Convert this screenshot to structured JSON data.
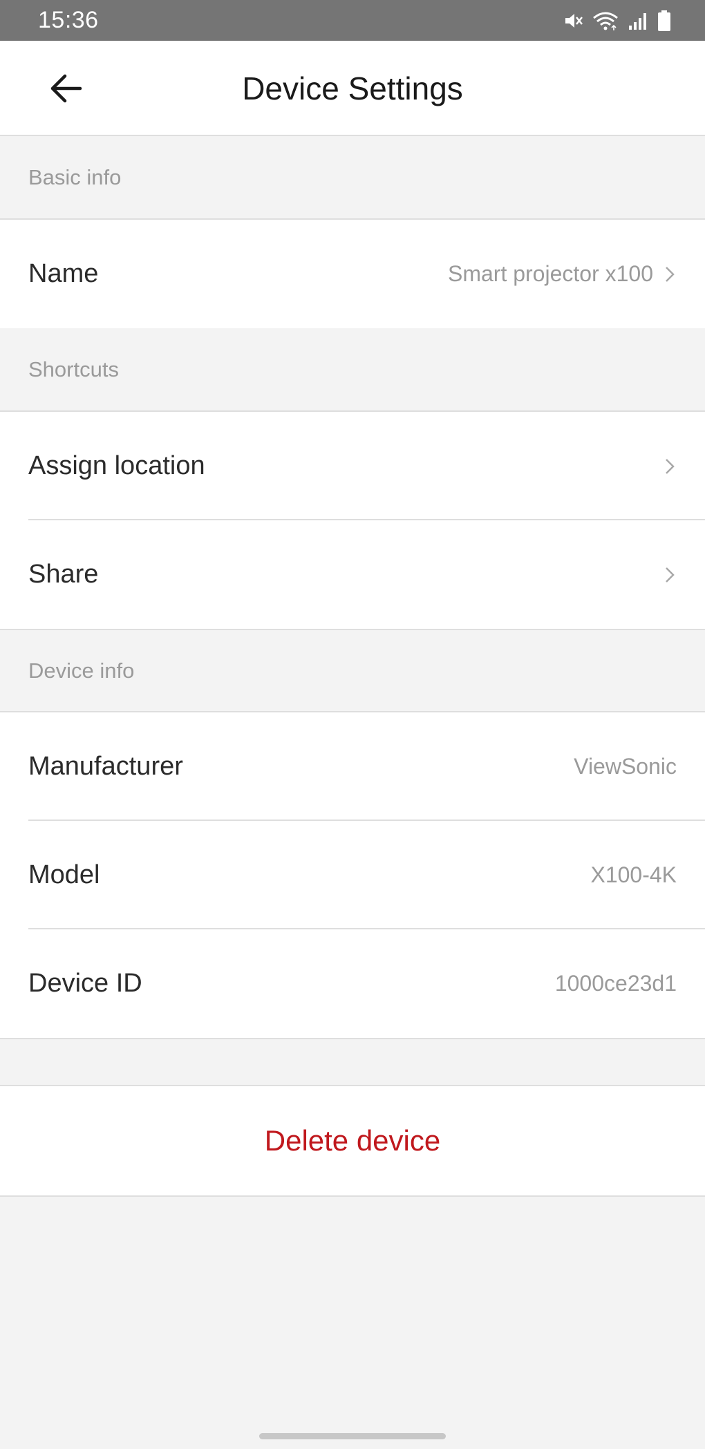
{
  "status_bar": {
    "time": "15:36",
    "icons": [
      "mute-icon",
      "wifi-icon",
      "signal-icon",
      "battery-icon"
    ]
  },
  "header": {
    "title": "Device Settings",
    "back_icon": "arrow-left-icon"
  },
  "sections": {
    "basic_info": {
      "title": "Basic info",
      "name": {
        "label": "Name",
        "value": "Smart projector x100"
      }
    },
    "shortcuts": {
      "title": "Shortcuts",
      "assign_location": {
        "label": "Assign location"
      },
      "share": {
        "label": "Share"
      }
    },
    "device_info": {
      "title": "Device info",
      "manufacturer": {
        "label": "Manufacturer",
        "value": "ViewSonic"
      },
      "model": {
        "label": "Model",
        "value": "X100-4K"
      },
      "device_id": {
        "label": "Device ID",
        "value": "1000ce23d1"
      }
    }
  },
  "actions": {
    "delete_label": "Delete device"
  },
  "colors": {
    "status_bar": "#757575",
    "background": "#f3f3f3",
    "surface": "#ffffff",
    "section_text": "#9a9a9a",
    "primary_text": "#2b2b2b",
    "danger": "#c0181d"
  }
}
